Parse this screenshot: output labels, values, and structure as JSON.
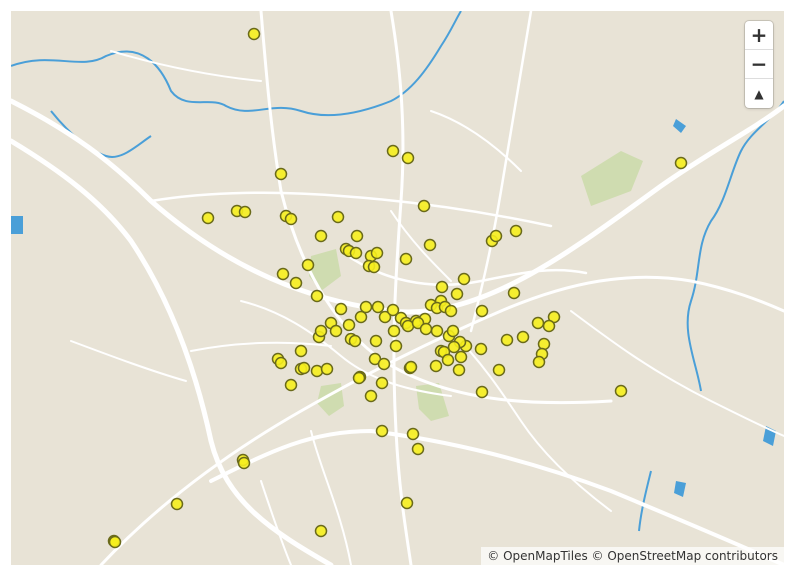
{
  "map": {
    "controls": {
      "zoom_in_label": "+",
      "zoom_out_label": "−",
      "compass_label": "▲"
    },
    "attribution": "© OpenMapTiles © OpenStreetMap contributors",
    "colors": {
      "land": "#e8e3d6",
      "road": "#ffffff",
      "water": "#4a9fd8",
      "park": "#cfdcb0",
      "marker_fill": "#f6ee1e",
      "marker_stroke": "#6a6a1a"
    },
    "marker_count": 150
  }
}
